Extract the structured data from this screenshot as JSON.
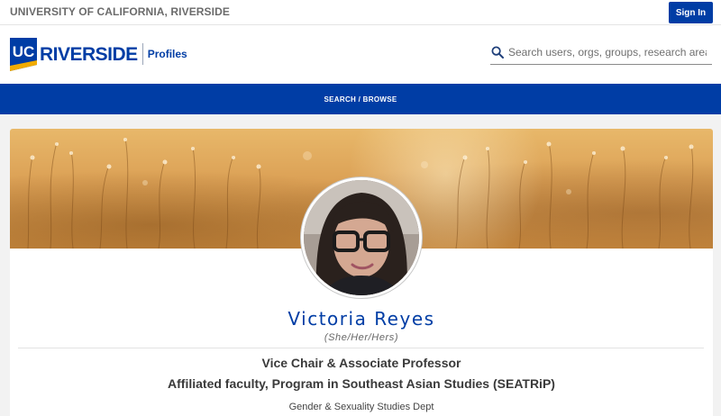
{
  "topbar": {
    "university": "UNIVERSITY OF CALIFORNIA, RIVERSIDE",
    "signin_label": "Sign In"
  },
  "header": {
    "logo_mark": "UC",
    "logo_word": "RIVERSIDE",
    "logo_sub": "Profiles",
    "search_placeholder": "Search users, orgs, groups, research areas",
    "search_value": ""
  },
  "nav": {
    "label": "SEARCH / BROWSE"
  },
  "profile": {
    "name": "Victoria Reyes",
    "pronouns": "(She/Her/Hers)",
    "title1": "Vice Chair & Associate Professor",
    "title2": "Affiliated faculty, Program in Southeast Asian Studies (SEATRiP)",
    "department": "Gender & Sexuality Studies Dept"
  },
  "icons": {
    "search": "search-icon",
    "logo": "ucr-logo-icon"
  },
  "colors": {
    "brand_blue": "#003da5",
    "brand_gold": "#f1ab00"
  }
}
